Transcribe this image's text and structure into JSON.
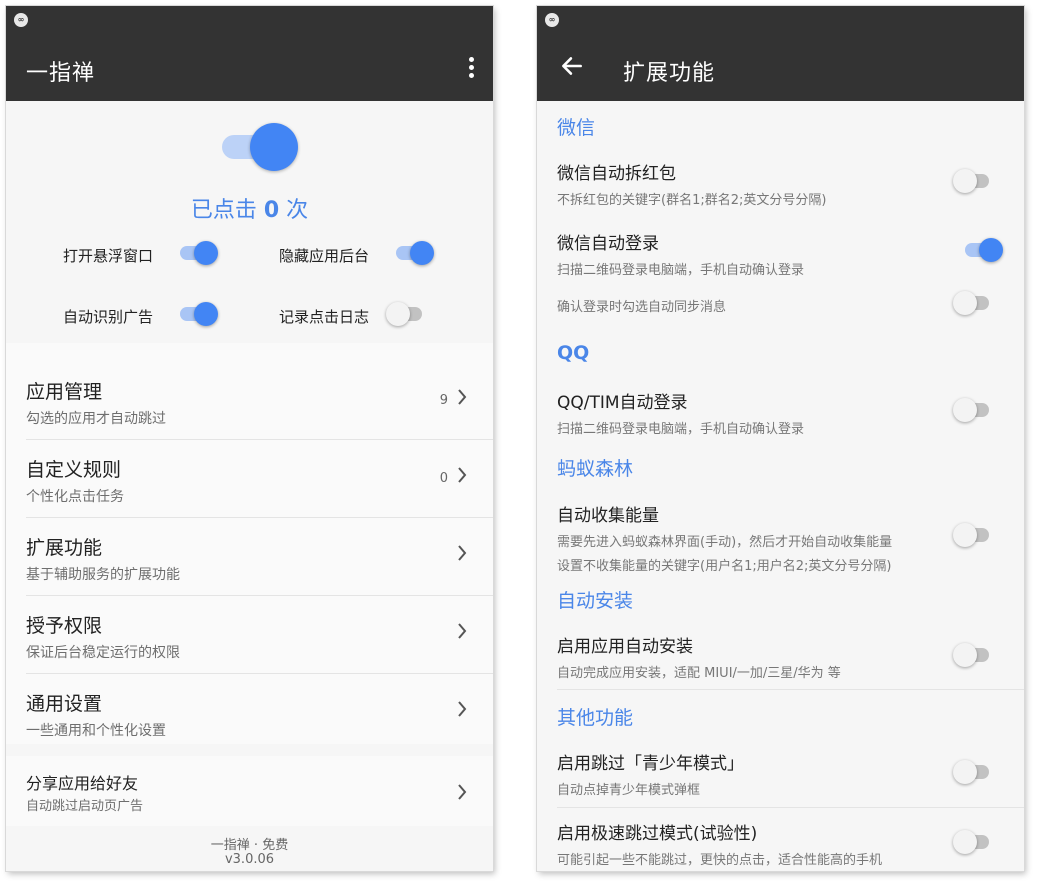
{
  "colors": {
    "accent": "#4285f4",
    "appbar": "#333333",
    "section": "#4a86e8"
  },
  "left": {
    "status_icon": "∞",
    "title": "一指禅",
    "more_icon": "more-vert-icon",
    "master_switch": true,
    "click_count": {
      "prefix": "已点击",
      "count": "0",
      "suffix": "次"
    },
    "options": [
      {
        "label": "打开悬浮窗口",
        "on": true
      },
      {
        "label": "隐藏应用后台",
        "on": true
      },
      {
        "label": "自动识别广告",
        "on": true
      },
      {
        "label": "记录点击日志",
        "on": false
      }
    ],
    "menu": [
      {
        "title": "应用管理",
        "subtitle": "勾选的应用才自动跳过",
        "count": "9"
      },
      {
        "title": "自定义规则",
        "subtitle": "个性化点击任务",
        "count": "0"
      },
      {
        "title": "扩展功能",
        "subtitle": "基于辅助服务的扩展功能",
        "count": ""
      },
      {
        "title": "授予权限",
        "subtitle": "保证后台稳定运行的权限",
        "count": ""
      },
      {
        "title": "通用设置",
        "subtitle": "一些通用和个性化设置",
        "count": ""
      }
    ],
    "share": {
      "title": "分享应用给好友",
      "subtitle": "自动跳过启动页广告"
    },
    "footer": {
      "line1": "一指禅 · 免费",
      "version": "v3.0.06"
    }
  },
  "right": {
    "status_icon": "∞",
    "title": "扩展功能",
    "back_icon": "arrow-back-icon",
    "sections": [
      {
        "header": "微信"
      },
      {
        "header": "QQ"
      },
      {
        "header": "蚂蚁森林"
      },
      {
        "header": "自动安装"
      },
      {
        "header": "其他功能"
      }
    ],
    "settings": [
      {
        "title": "微信自动拆红包",
        "subtitle": "不拆红包的关键字(群名1;群名2;英文分号分隔)",
        "on": false
      },
      {
        "title": "微信自动登录",
        "subtitle": "扫描二维码登录电脑端，手机自动确认登录",
        "on": true
      },
      {
        "title": "",
        "subtitle": "确认登录时勾选自动同步消息",
        "on": false
      },
      {
        "title": "QQ/TIM自动登录",
        "subtitle": "扫描二维码登录电脑端，手机自动确认登录",
        "on": false
      },
      {
        "title": "自动收集能量",
        "subtitle": "需要先进入蚂蚁森林界面(手动)，然后才开始自动收集能量",
        "subtitle2": "设置不收集能量的关键字(用户名1;用户名2;英文分号分隔)",
        "on": false
      },
      {
        "title": "启用应用自动安装",
        "subtitle": "自动完成应用安装，适配 MIUI/一加/三星/华为 等",
        "on": false
      },
      {
        "title": "启用跳过「青少年模式」",
        "subtitle": "自动点掉青少年模式弹框",
        "on": false
      },
      {
        "title": "启用极速跳过模式(试验性)",
        "subtitle": "可能引起一些不能跳过，更快的点击，适合性能高的手机",
        "on": false
      }
    ]
  }
}
